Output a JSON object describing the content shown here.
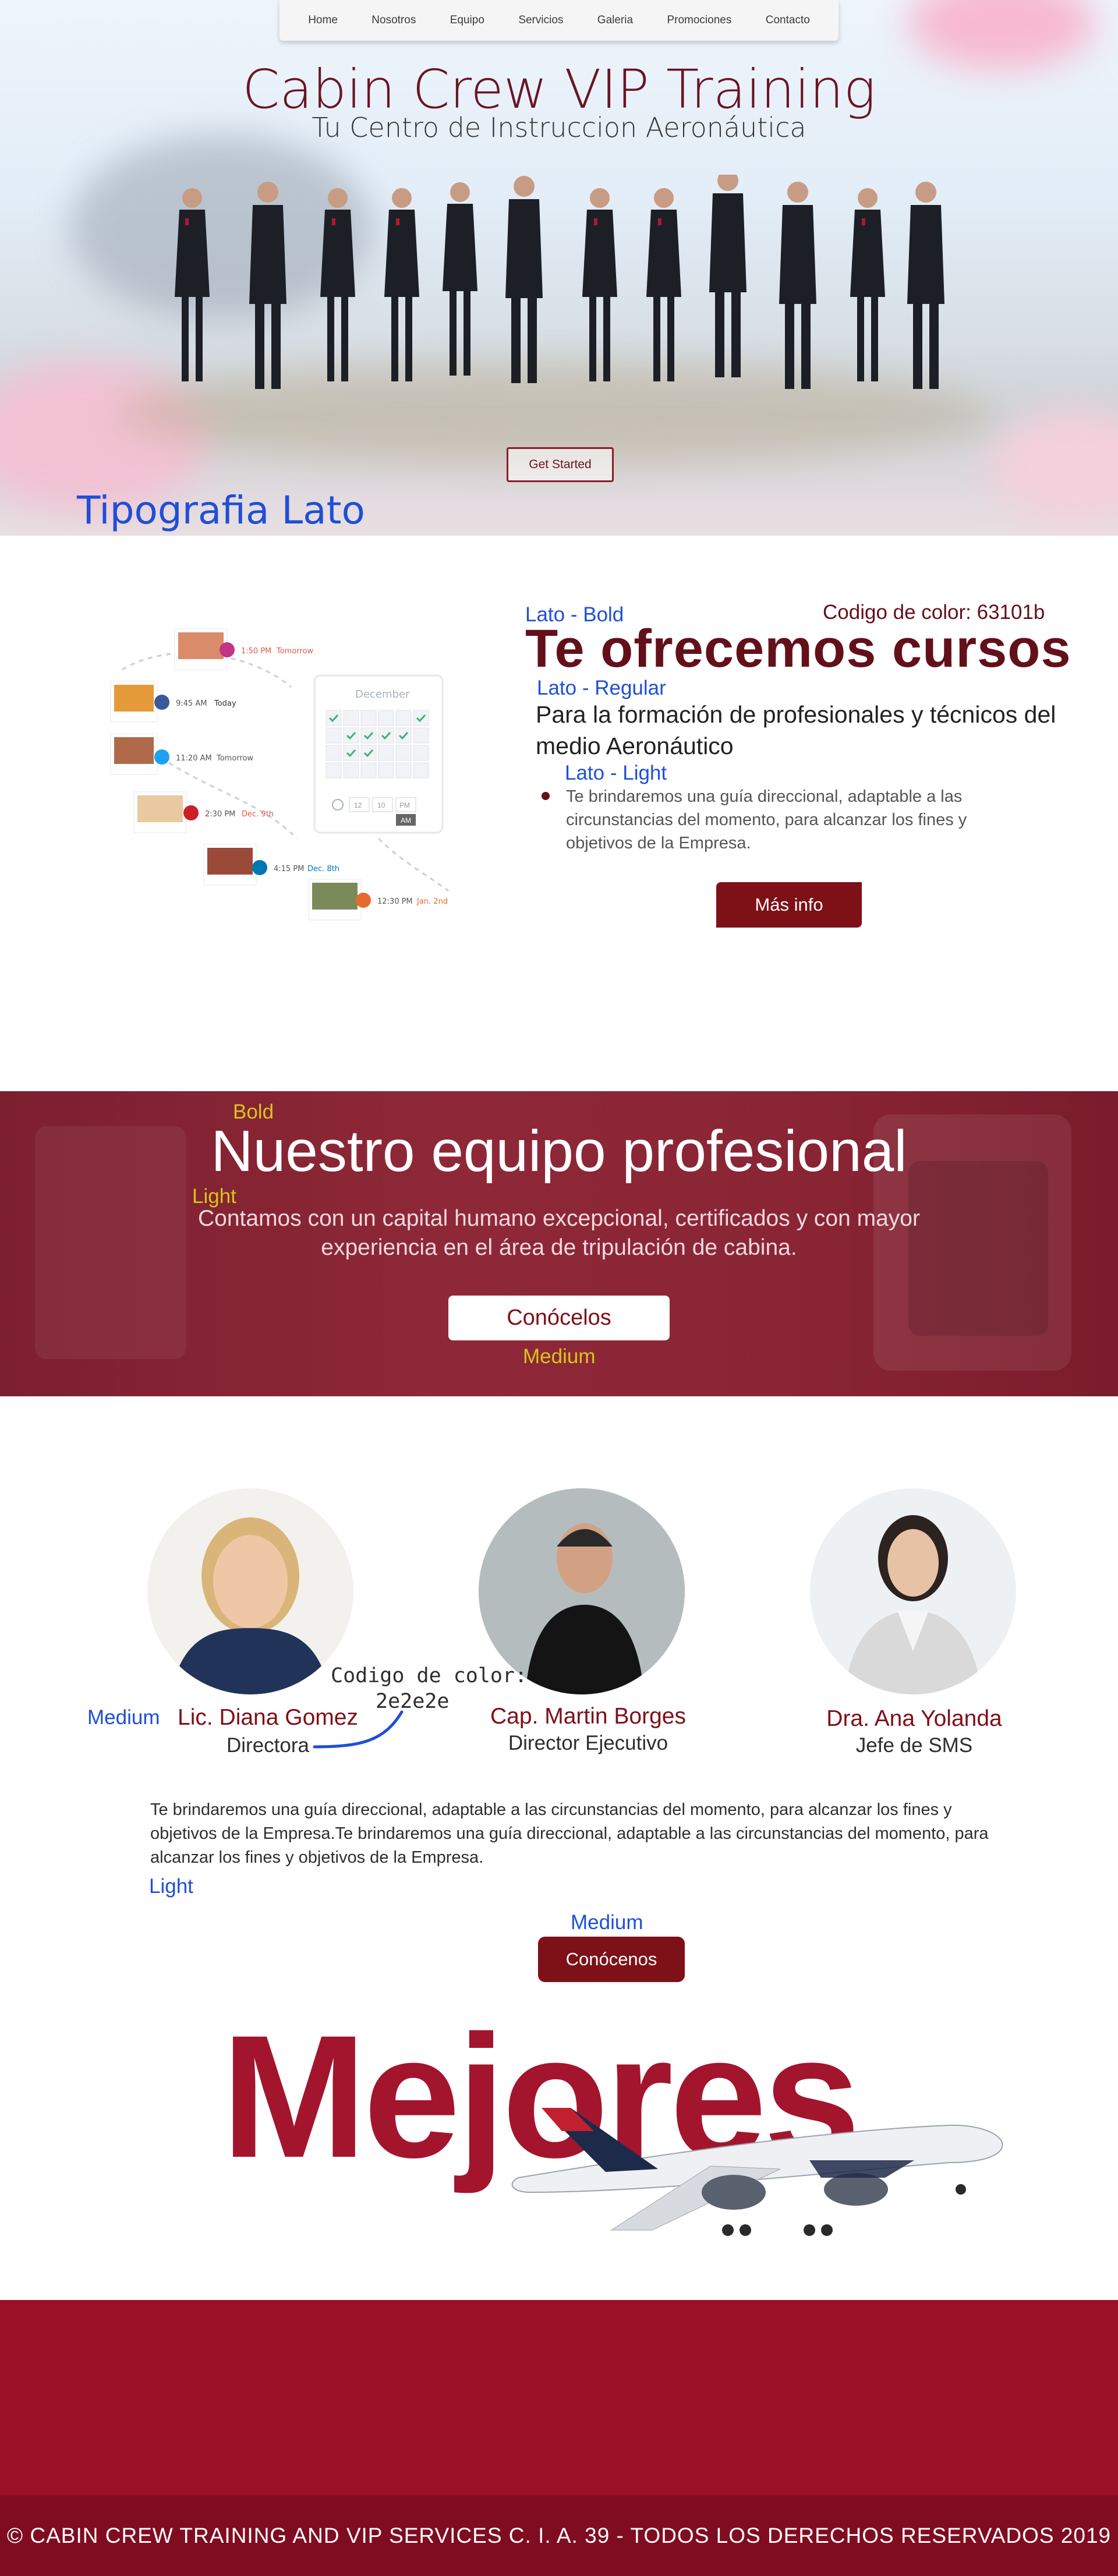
{
  "nav": {
    "items": [
      "Home",
      "Nosotros",
      "Equipo",
      "Servicios",
      "Galeria",
      "Promociones",
      "Contacto"
    ]
  },
  "hero": {
    "title": "Cabin Crew VIP Training",
    "subtitle": "Tu Centro de Instruccion Aeronáutica",
    "cta_label": "Get Started",
    "typography_note": "Tipografia Lato"
  },
  "courses": {
    "note_bold": "Lato - Bold",
    "color_note": "Codigo de color: 63101b",
    "title": "Te ofrecemos cursos",
    "note_regular": "Lato - Regular",
    "subtitle": "Para la formación de profesionales y técnicos del medio Aeronáutico",
    "note_light": "Lato - Light",
    "text": "Te brindaremos una guía direccional, adaptable a las circunstancias del momento, para alcanzar los fines y objetivos de la Empresa.",
    "button_label": "Más info",
    "calendar": {
      "month": "December",
      "posts": [
        {
          "time": "1:50 PM",
          "day": "Tomorrow",
          "network": "instagram"
        },
        {
          "time": "9:45 AM",
          "day": "Today",
          "network": "facebook"
        },
        {
          "time": "11:20 AM",
          "day": "Tomorrow",
          "network": "twitter"
        },
        {
          "time": "2:30 PM",
          "day": "Dec. 9th",
          "network": "pinterest"
        },
        {
          "time": "4:15 PM",
          "day": "Dec. 8th",
          "network": "linkedin"
        },
        {
          "time": "12:30 PM",
          "day": "Jan. 2nd",
          "network": "calendar"
        }
      ],
      "time_boxes": [
        "12",
        "10",
        "PM"
      ],
      "am_label": "AM"
    }
  },
  "team_banner": {
    "note_bold": "Bold",
    "title": "Nuestro equipo profesional",
    "note_light": "Light",
    "text": "Contamos con un capital humano excepcional, certificados y con mayor experiencia en el área de tripulación de cabina.",
    "button_label": "Conócelos",
    "note_medium": "Medium"
  },
  "people": {
    "note_medium": "Medium",
    "color_note_line1": "Codigo de color:",
    "color_note_line2": "2e2e2e",
    "members": [
      {
        "name": "Lic. Diana Gomez",
        "role": "Directora"
      },
      {
        "name": "Cap. Martin Borges",
        "role": "Director Ejecutivo"
      },
      {
        "name": "Dra. Ana Yolanda",
        "role": "Jefe de SMS"
      }
    ],
    "paragraph": "Te brindaremos una guía direccional, adaptable a las circunstancias del momento, para alcanzar los fines y objetivos de la Empresa.Te brindaremos una guía direccional, adaptable a las circunstancias del momento, para alcanzar los fines y objetivos de la Empresa.",
    "note_light": "Light",
    "note_medium_button": "Medium",
    "button_label": "Conócenos"
  },
  "mejores": {
    "word": "Mejores"
  },
  "footer": {
    "text": "© CABIN CREW TRAINING AND VIP SERVICES C. I. A. 39 - TODOS LOS DERECHOS RESERVADOS 2019"
  },
  "colors": {
    "brand": "#63101b",
    "text": "#2e2e2e",
    "button": "#7e1018",
    "footer": "#9b1027",
    "note_blue": "#1f4fd6",
    "note_yellow": "#d8c61a"
  }
}
